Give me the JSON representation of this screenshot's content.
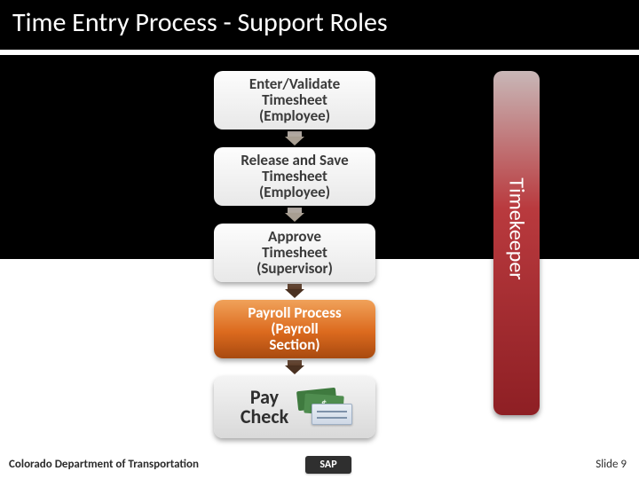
{
  "title": "Time Entry Process - Support Roles",
  "sidebar": {
    "label": "Timekeeper"
  },
  "flow": {
    "steps": [
      {
        "label_line1": "Enter/Validate",
        "label_line2": "Timesheet",
        "label_line3": "(Employee)"
      },
      {
        "label_line1": "Release and Save",
        "label_line2": "Timesheet",
        "label_line3": "(Employee)"
      },
      {
        "label_line1": "Approve",
        "label_line2": "Timesheet",
        "label_line3": "(Supervisor)"
      },
      {
        "label_line1": "Payroll Process",
        "label_line2": "(Payroll",
        "label_line3": "Section)"
      }
    ],
    "paycheck": {
      "line1": "Pay",
      "line2": "Check",
      "dollar": "$"
    }
  },
  "footer": {
    "org": "Colorado Department of Transportation",
    "center_label": "SAP",
    "slide_label": "Slide 9"
  }
}
